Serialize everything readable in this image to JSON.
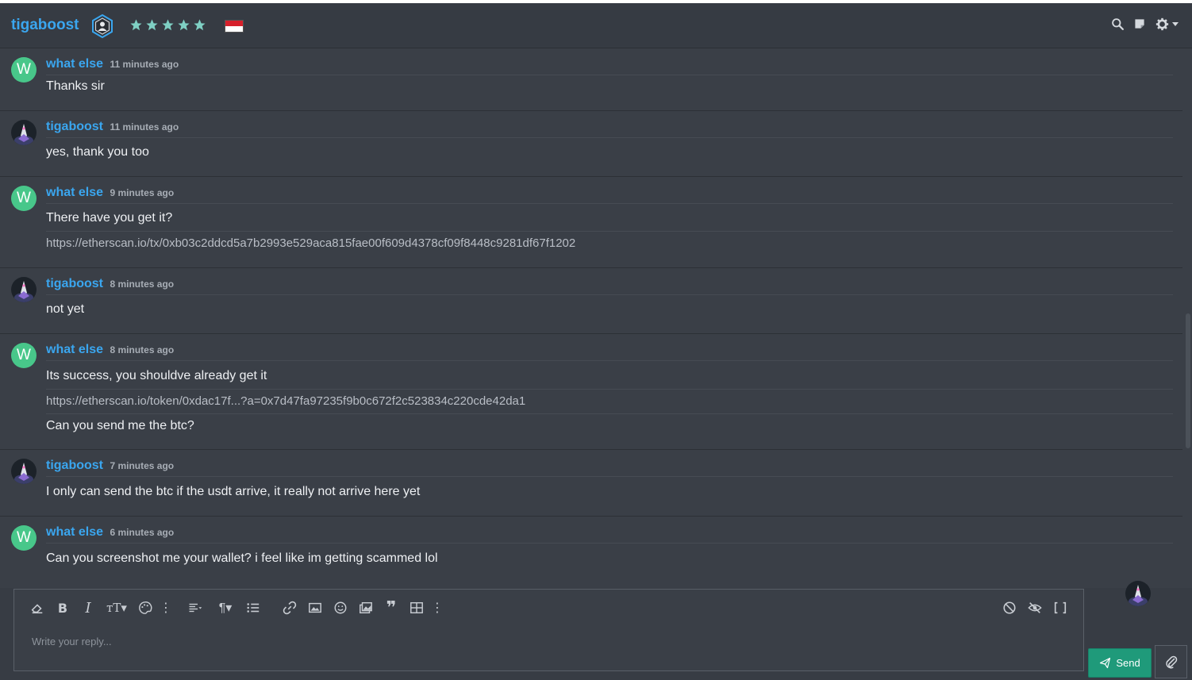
{
  "header": {
    "title": "tigaboost",
    "rating_stars": 5,
    "icons": [
      "user-badge-icon",
      "star-icon",
      "indonesia-flag-icon",
      "search-icon",
      "notes-icon",
      "gear-icon",
      "caret-down-icon"
    ]
  },
  "messages": [
    {
      "author": "what else",
      "avatar": "W",
      "time": "11 minutes ago",
      "lines": [
        {
          "text": "Thanks sir",
          "link": false
        }
      ]
    },
    {
      "author": "tigaboost",
      "avatar": "",
      "time": "11 minutes ago",
      "lines": [
        {
          "text": "yes, thank you too",
          "link": false
        }
      ]
    },
    {
      "author": "what else",
      "avatar": "W",
      "time": "9 minutes ago",
      "lines": [
        {
          "text": "There have you get it?",
          "link": false
        },
        {
          "text": "https://etherscan.io/tx/0xb03c2ddcd5a7b2993e529aca815fae00f609d4378cf09f8448c9281df67f1202",
          "link": true
        }
      ]
    },
    {
      "author": "tigaboost",
      "avatar": "",
      "time": "8 minutes ago",
      "lines": [
        {
          "text": "not yet",
          "link": false
        }
      ]
    },
    {
      "author": "what else",
      "avatar": "W",
      "time": "8 minutes ago",
      "lines": [
        {
          "text": "Its success, you shouldve already get it",
          "link": false
        },
        {
          "text": "https://etherscan.io/token/0xdac17f...?a=0x7d47fa97235f9b0c672f2c523834c220cde42da1",
          "link": true
        },
        {
          "text": "Can you send me the btc?",
          "link": false
        }
      ]
    },
    {
      "author": "tigaboost",
      "avatar": "",
      "time": "7 minutes ago",
      "lines": [
        {
          "text": "I only can send the btc if the usdt arrive, it really not arrive here yet",
          "link": false
        }
      ]
    },
    {
      "author": "what else",
      "avatar": "W",
      "time": "6 minutes ago",
      "lines": [
        {
          "text": "Can you screenshot me your wallet? i feel like im getting scammed lol",
          "link": false
        }
      ]
    }
  ],
  "editor": {
    "placeholder": "Write your reply...",
    "send_label": "Send",
    "toolbar_icons": [
      "eraser-icon",
      "bold-icon",
      "italic-icon",
      "text-size-icon",
      "palette-icon",
      "more-icon",
      "align-icon",
      "paragraph-icon",
      "list-icon",
      "link-icon",
      "image-icon",
      "emoji-icon",
      "gallery-icon",
      "quote-icon",
      "table-icon",
      "more-icon",
      "no-preview-icon",
      "eye-slash-icon",
      "fullscreen-icon"
    ]
  },
  "colors": {
    "accent": "#3aa6ef",
    "send": "#1f9a7a",
    "avatar_w": "#48c78a",
    "background": "#373c44"
  }
}
